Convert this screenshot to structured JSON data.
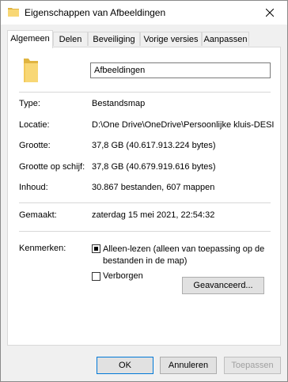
{
  "window": {
    "title": "Eigenschappen van Afbeeldingen"
  },
  "tabs": [
    {
      "label": "Algemeen",
      "active": true
    },
    {
      "label": "Delen",
      "active": false
    },
    {
      "label": "Beveiliging",
      "active": false
    },
    {
      "label": "Vorige versies",
      "active": false
    },
    {
      "label": "Aanpassen",
      "active": false
    }
  ],
  "general": {
    "name": "Afbeeldingen",
    "type_label": "Type:",
    "type_value": "Bestandsmap",
    "location_label": "Locatie:",
    "location_value": "D:\\One Drive\\OneDrive\\Persoonlijke kluis-DESI",
    "size_label": "Grootte:",
    "size_value": "37,8 GB (40.617.913.224 bytes)",
    "disk_size_label": "Grootte op schijf:",
    "disk_size_value": "37,8 GB (40.679.919.616 bytes)",
    "contents_label": "Inhoud:",
    "contents_value": "30.867 bestanden, 607 mappen",
    "created_label": "Gemaakt:",
    "created_value": "zaterdag 15 mei 2021, 22:54:32",
    "attributes_label": "Kenmerken:",
    "readonly_label": "Alleen-lezen (alleen van toepassing op de bestanden in de map)",
    "readonly_state": "indeterminate",
    "hidden_label": "Verborgen",
    "hidden_checked": false,
    "advanced_label": "Geavanceerd..."
  },
  "buttons": {
    "ok": "OK",
    "cancel": "Annuleren",
    "apply": "Toepassen"
  },
  "colors": {
    "folder_yellow": "#f8d775",
    "folder_dark": "#e0b440",
    "accent_blue": "#0078d7"
  }
}
